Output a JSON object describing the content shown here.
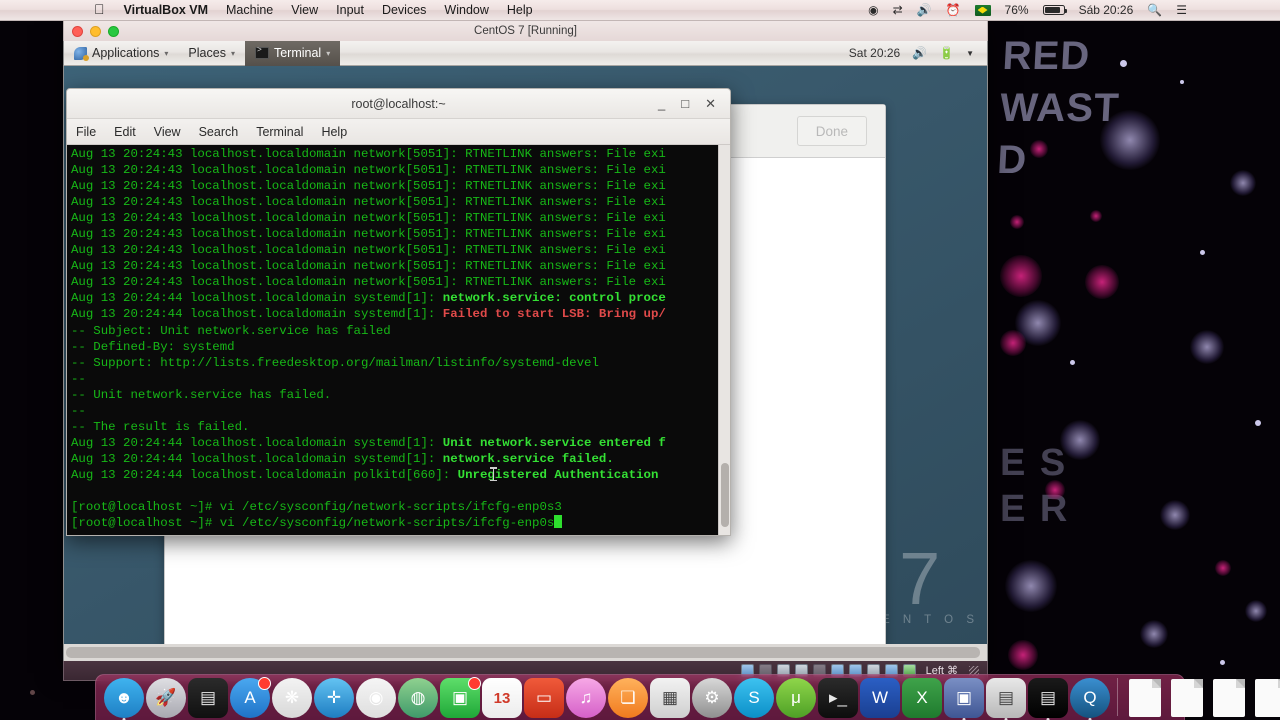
{
  "mac_menubar": {
    "apple_icon": "apple-logo-icon",
    "items": [
      {
        "label": "VirtualBox VM",
        "bold": true
      },
      {
        "label": "Machine",
        "bold": false
      },
      {
        "label": "View",
        "bold": false
      },
      {
        "label": "Input",
        "bold": false
      },
      {
        "label": "Devices",
        "bold": false
      },
      {
        "label": "Window",
        "bold": false
      },
      {
        "label": "Help",
        "bold": false
      }
    ],
    "status": {
      "record_icon": "record-icon",
      "airdrop_icon": "airdrop-icon",
      "volume_icon": "volume-icon",
      "timemachine_icon": "time-machine-icon",
      "flag_icon": "brazil-flag-icon",
      "battery_percent": "76%",
      "battery_icon": "battery-icon",
      "clock": "Sáb 20:26",
      "search_icon": "search-icon",
      "notification_icon": "notification-center-icon"
    }
  },
  "vbox_window": {
    "title": "CentOS 7 [Running]",
    "close_label": "",
    "minimize_label": "",
    "zoom_label": ""
  },
  "gnome_panel": {
    "applications_label": "Applications",
    "places_label": "Places",
    "terminal_label": "Terminal",
    "caret": "▾",
    "clock": "Sat 20:26",
    "volume_icon": "volume-icon",
    "battery_icon": "battery-icon",
    "arrow_icon": "chevron-down-icon"
  },
  "bg_window": {
    "done_label": "Done"
  },
  "terminal": {
    "title": "root@localhost:~",
    "minimize_glyph": "_",
    "maximize_glyph": "□",
    "close_glyph": "✕",
    "menu": [
      "File",
      "Edit",
      "View",
      "Search",
      "Terminal",
      "Help"
    ],
    "lines": [
      {
        "segments": [
          {
            "t": "Aug 13 20:24:43 localhost.localdomain network[5051]: RTNETLINK answers: File exi",
            "c": "g"
          }
        ]
      },
      {
        "segments": [
          {
            "t": "Aug 13 20:24:43 localhost.localdomain network[5051]: RTNETLINK answers: File exi",
            "c": "g"
          }
        ]
      },
      {
        "segments": [
          {
            "t": "Aug 13 20:24:43 localhost.localdomain network[5051]: RTNETLINK answers: File exi",
            "c": "g"
          }
        ]
      },
      {
        "segments": [
          {
            "t": "Aug 13 20:24:43 localhost.localdomain network[5051]: RTNETLINK answers: File exi",
            "c": "g"
          }
        ]
      },
      {
        "segments": [
          {
            "t": "Aug 13 20:24:43 localhost.localdomain network[5051]: RTNETLINK answers: File exi",
            "c": "g"
          }
        ]
      },
      {
        "segments": [
          {
            "t": "Aug 13 20:24:43 localhost.localdomain network[5051]: RTNETLINK answers: File exi",
            "c": "g"
          }
        ]
      },
      {
        "segments": [
          {
            "t": "Aug 13 20:24:43 localhost.localdomain network[5051]: RTNETLINK answers: File exi",
            "c": "g"
          }
        ]
      },
      {
        "segments": [
          {
            "t": "Aug 13 20:24:43 localhost.localdomain network[5051]: RTNETLINK answers: File exi",
            "c": "g"
          }
        ]
      },
      {
        "segments": [
          {
            "t": "Aug 13 20:24:43 localhost.localdomain network[5051]: RTNETLINK answers: File exi",
            "c": "g"
          }
        ]
      },
      {
        "segments": [
          {
            "t": "Aug 13 20:24:44 localhost.localdomain systemd[1]: ",
            "c": "g"
          },
          {
            "t": "network.service: control proce",
            "c": "gb"
          }
        ]
      },
      {
        "segments": [
          {
            "t": "Aug 13 20:24:44 localhost.localdomain systemd[1]: ",
            "c": "g"
          },
          {
            "t": "Failed to start LSB: Bring up/",
            "c": "rb"
          }
        ]
      },
      {
        "segments": [
          {
            "t": "-- Subject: Unit network.service has failed",
            "c": "g"
          }
        ]
      },
      {
        "segments": [
          {
            "t": "-- Defined-By: systemd",
            "c": "g"
          }
        ]
      },
      {
        "segments": [
          {
            "t": "-- Support: http://lists.freedesktop.org/mailman/listinfo/systemd-devel",
            "c": "g"
          }
        ]
      },
      {
        "segments": [
          {
            "t": "--",
            "c": "g"
          }
        ]
      },
      {
        "segments": [
          {
            "t": "-- Unit network.service has failed.",
            "c": "g"
          }
        ]
      },
      {
        "segments": [
          {
            "t": "--",
            "c": "g"
          }
        ]
      },
      {
        "segments": [
          {
            "t": "-- The result is failed.",
            "c": "g"
          }
        ]
      },
      {
        "segments": [
          {
            "t": "Aug 13 20:24:44 localhost.localdomain systemd[1]: ",
            "c": "g"
          },
          {
            "t": "Unit network.service entered f",
            "c": "gb"
          }
        ]
      },
      {
        "segments": [
          {
            "t": "Aug 13 20:24:44 localhost.localdomain systemd[1]: ",
            "c": "g"
          },
          {
            "t": "network.service failed.",
            "c": "gb"
          }
        ]
      },
      {
        "segments": [
          {
            "t": "Aug 13 20:24:44 localhost.localdomain polkitd[660]: ",
            "c": "g"
          },
          {
            "t": "Unregistered Authentication",
            "c": "gb"
          }
        ]
      },
      {
        "segments": [
          {
            "t": "",
            "c": "g"
          }
        ]
      },
      {
        "segments": [
          {
            "t": "[root@localhost ~]# vi /etc/sysconfig/network-scripts/ifcfg-enp0s3",
            "c": "g"
          }
        ]
      },
      {
        "segments": [
          {
            "t": "[root@localhost ~]# vi /etc/sysconfig/network-scripts/ifcfg-enp0s",
            "c": "g"
          }
        ],
        "cursor": true
      }
    ]
  },
  "centos_watermark": {
    "version": "7",
    "name": "C E N T O S"
  },
  "vbox_status": {
    "host_key": "Left ⌘",
    "icons": [
      "harddisk-icon",
      "cd-icon",
      "network-icon",
      "usb-icon",
      "sharedfolder-icon",
      "display-icon",
      "videocapture-icon",
      "mouse-icon",
      "keyboard-icon",
      "settings-icon"
    ]
  },
  "dock": {
    "items": [
      {
        "name": "finder",
        "glyph": "☻",
        "bg": "linear-gradient(180deg,#3fb3ef,#1e7fc4)",
        "badge": false,
        "running": true
      },
      {
        "name": "launchpad",
        "glyph": "🚀",
        "bg": "linear-gradient(180deg,#dfdfe3,#a8a8b0)",
        "badge": false,
        "running": false
      },
      {
        "name": "mission-control",
        "glyph": "▤",
        "bg": "linear-gradient(180deg,#2b2b2b,#101010)",
        "badge": false,
        "running": false
      },
      {
        "name": "app-store",
        "glyph": "A",
        "bg": "linear-gradient(180deg,#4aa8f0,#1f73c8)",
        "badge": true,
        "running": false
      },
      {
        "name": "photos",
        "glyph": "❋",
        "bg": "linear-gradient(180deg,#f3f3f3,#d8d8d8)",
        "badge": false,
        "running": false
      },
      {
        "name": "safari",
        "glyph": "✛",
        "bg": "linear-gradient(180deg,#63c3f2,#1e7dc2)",
        "badge": false,
        "running": false
      },
      {
        "name": "google-chrome",
        "glyph": "◉",
        "bg": "linear-gradient(180deg,#f5f5f5,#dedede)",
        "badge": false,
        "running": false
      },
      {
        "name": "maps",
        "glyph": "◍",
        "bg": "linear-gradient(180deg,#8fd18f,#3f9a6a)",
        "badge": false,
        "running": false
      },
      {
        "name": "facetime",
        "glyph": "▣",
        "bg": "linear-gradient(180deg,#5ede6a,#1fa838)",
        "badge": true,
        "running": false
      },
      {
        "name": "calendar",
        "glyph": "13",
        "bg": "linear-gradient(180deg,#ffffff,#ececec)",
        "badge": false,
        "running": false
      },
      {
        "name": "screen-sharing",
        "glyph": "▭",
        "bg": "linear-gradient(180deg,#f05a3a,#c62d17)",
        "badge": false,
        "running": false
      },
      {
        "name": "itunes",
        "glyph": "♫",
        "bg": "linear-gradient(180deg,#f7a8e6,#d560c8)",
        "badge": false,
        "running": false
      },
      {
        "name": "ibooks",
        "glyph": "❏",
        "bg": "linear-gradient(180deg,#ffb25c,#f07a1e)",
        "badge": false,
        "running": false
      },
      {
        "name": "photo-booth",
        "glyph": "▦",
        "bg": "linear-gradient(180deg,#f2f2f2,#cfcfcf)",
        "badge": false,
        "running": false
      },
      {
        "name": "system-preferences",
        "glyph": "⚙",
        "bg": "linear-gradient(180deg,#d8d8d8,#8f8f8f)",
        "badge": false,
        "running": false
      },
      {
        "name": "skype",
        "glyph": "S",
        "bg": "linear-gradient(180deg,#3dc2f0,#0b8fc8)",
        "badge": false,
        "running": false
      },
      {
        "name": "utorrent",
        "glyph": "μ",
        "bg": "linear-gradient(180deg,#8fd64a,#4ea026)",
        "badge": false,
        "running": false
      },
      {
        "name": "terminal",
        "glyph": "▸_",
        "bg": "linear-gradient(180deg,#2b2b2b,#0d0d0d)",
        "badge": false,
        "running": false
      },
      {
        "name": "microsoft-word",
        "glyph": "W",
        "bg": "linear-gradient(180deg,#2b5fc4,#1a3f91)",
        "badge": false,
        "running": false
      },
      {
        "name": "microsoft-excel",
        "glyph": "X",
        "bg": "linear-gradient(180deg,#3fa34a,#1f7a2e)",
        "badge": false,
        "running": false
      },
      {
        "name": "virtualbox",
        "glyph": "▣",
        "bg": "linear-gradient(180deg,#7a8fc4,#3f5694)",
        "badge": false,
        "running": true
      },
      {
        "name": "vm-window-1",
        "glyph": "▤",
        "bg": "linear-gradient(180deg,#e8e8e8,#b8b8b8)",
        "badge": false,
        "running": true
      },
      {
        "name": "vm-window-2",
        "glyph": "▤",
        "bg": "linear-gradient(180deg,#1a1a1a,#000000)",
        "badge": false,
        "running": true
      },
      {
        "name": "quicktime",
        "glyph": "Q",
        "bg": "linear-gradient(180deg,#3a8fd0,#15527f)",
        "badge": false,
        "running": true
      }
    ],
    "files": [
      {
        "name": "document-1"
      },
      {
        "name": "document-2"
      },
      {
        "name": "folder-preview-1"
      },
      {
        "name": "folder-preview-2"
      }
    ],
    "trash_name": "trash"
  },
  "wallpaper": {
    "text_top": "RED\nWAST\nD",
    "text_bottom": "E S\nE R"
  }
}
